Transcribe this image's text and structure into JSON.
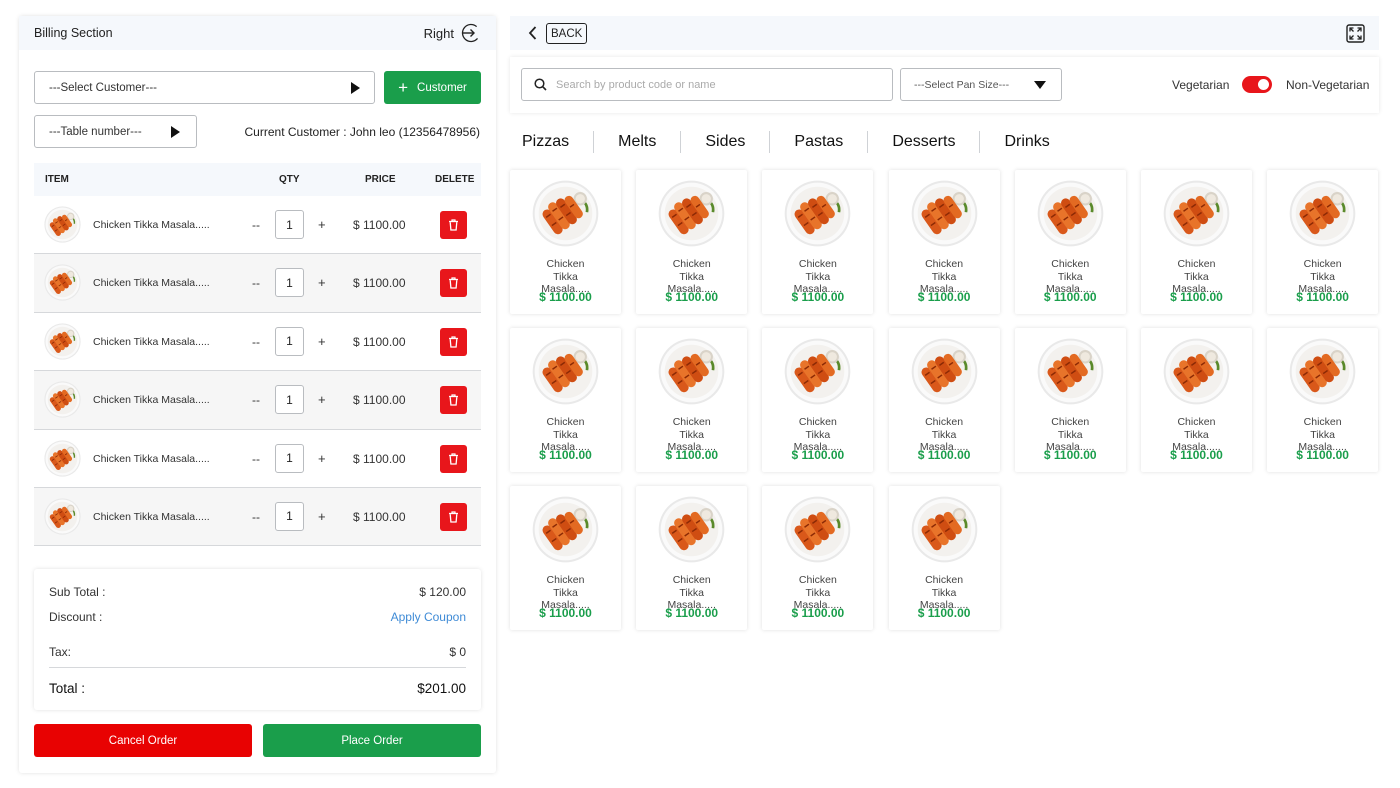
{
  "billing": {
    "title": "Billing Section",
    "right_label": "Right",
    "select_customer": "---Select Customer---",
    "add_customer_label": "Customer",
    "select_table": "---Table number---",
    "current_customer": "Current Customer : John leo (12356478956)",
    "columns": {
      "item": "ITEM",
      "qty": "QTY",
      "price": "PRICE",
      "delete": "DELETE"
    },
    "items": [
      {
        "name": "Chicken Tikka Masala.....",
        "minus": "--",
        "qty": "1",
        "plus": "+",
        "price": "$ 1100.00"
      },
      {
        "name": "Chicken Tikka Masala.....",
        "minus": "--",
        "qty": "1",
        "plus": "+",
        "price": "$ 1100.00"
      },
      {
        "name": "Chicken Tikka Masala.....",
        "minus": "--",
        "qty": "1",
        "plus": "+",
        "price": "$ 1100.00"
      },
      {
        "name": "Chicken Tikka Masala.....",
        "minus": "--",
        "qty": "1",
        "plus": "+",
        "price": "$ 1100.00"
      },
      {
        "name": "Chicken Tikka Masala.....",
        "minus": "--",
        "qty": "1",
        "plus": "+",
        "price": "$ 1100.00"
      },
      {
        "name": "Chicken Tikka Masala.....",
        "minus": "--",
        "qty": "1",
        "plus": "+",
        "price": "$ 1100.00"
      }
    ],
    "summary": {
      "subtotal_label": "Sub Total :",
      "subtotal_value": "$ 120.00",
      "discount_label": "Discount :",
      "discount_value": "Apply Coupon",
      "tax_label": "Tax:",
      "tax_value": "$ 0",
      "total_label": "Total :",
      "total_value": "$201.00"
    },
    "cancel_label": "Cancel Order",
    "place_label": "Place Order"
  },
  "menu": {
    "back_label": "BACK",
    "search_placeholder": "Search by product code or name",
    "pan_size": "---Select Pan Size---",
    "veg_label": "Vegetarian",
    "nonveg_label": "Non-Vegetarian",
    "toggle_on": true,
    "tabs": [
      "Pizzas",
      "Melts",
      "Sides",
      "Pastas",
      "Desserts",
      "Drinks"
    ],
    "products": [
      {
        "name": "Chicken Tikka Masala.....",
        "price": "$ 1100.00"
      },
      {
        "name": "Chicken Tikka Masala.....",
        "price": "$ 1100.00"
      },
      {
        "name": "Chicken Tikka Masala.....",
        "price": "$ 1100.00"
      },
      {
        "name": "Chicken Tikka Masala.....",
        "price": "$ 1100.00"
      },
      {
        "name": "Chicken Tikka Masala.....",
        "price": "$ 1100.00"
      },
      {
        "name": "Chicken Tikka Masala.....",
        "price": "$ 1100.00"
      },
      {
        "name": "Chicken Tikka Masala.....",
        "price": "$ 1100.00"
      },
      {
        "name": "Chicken Tikka Masala.....",
        "price": "$ 1100.00"
      },
      {
        "name": "Chicken Tikka Masala.....",
        "price": "$ 1100.00"
      },
      {
        "name": "Chicken Tikka Masala.....",
        "price": "$ 1100.00"
      },
      {
        "name": "Chicken Tikka Masala.....",
        "price": "$ 1100.00"
      },
      {
        "name": "Chicken Tikka Masala.....",
        "price": "$ 1100.00"
      },
      {
        "name": "Chicken Tikka Masala.....",
        "price": "$ 1100.00"
      },
      {
        "name": "Chicken Tikka Masala.....",
        "price": "$ 1100.00"
      },
      {
        "name": "Chicken Tikka Masala.....",
        "price": "$ 1100.00"
      },
      {
        "name": "Chicken Tikka Masala.....",
        "price": "$ 1100.00"
      },
      {
        "name": "Chicken Tikka Masala.....",
        "price": "$ 1100.00"
      },
      {
        "name": "Chicken Tikka Masala.....",
        "price": "$ 1100.00"
      }
    ]
  },
  "icons": {
    "right": "logout-arrow-icon",
    "add": "plus-icon",
    "back": "chevron-left-icon",
    "expand": "expand-icon",
    "search": "search-icon",
    "delete": "trash-icon",
    "dropdown": "triangle-down-icon",
    "play": "triangle-right-icon"
  },
  "colors": {
    "green": "#1a9e4b",
    "red": "#e8161b",
    "cancel_red": "#e80202",
    "link_blue": "#3f8bd6",
    "header_bg": "#f5f8fc"
  }
}
